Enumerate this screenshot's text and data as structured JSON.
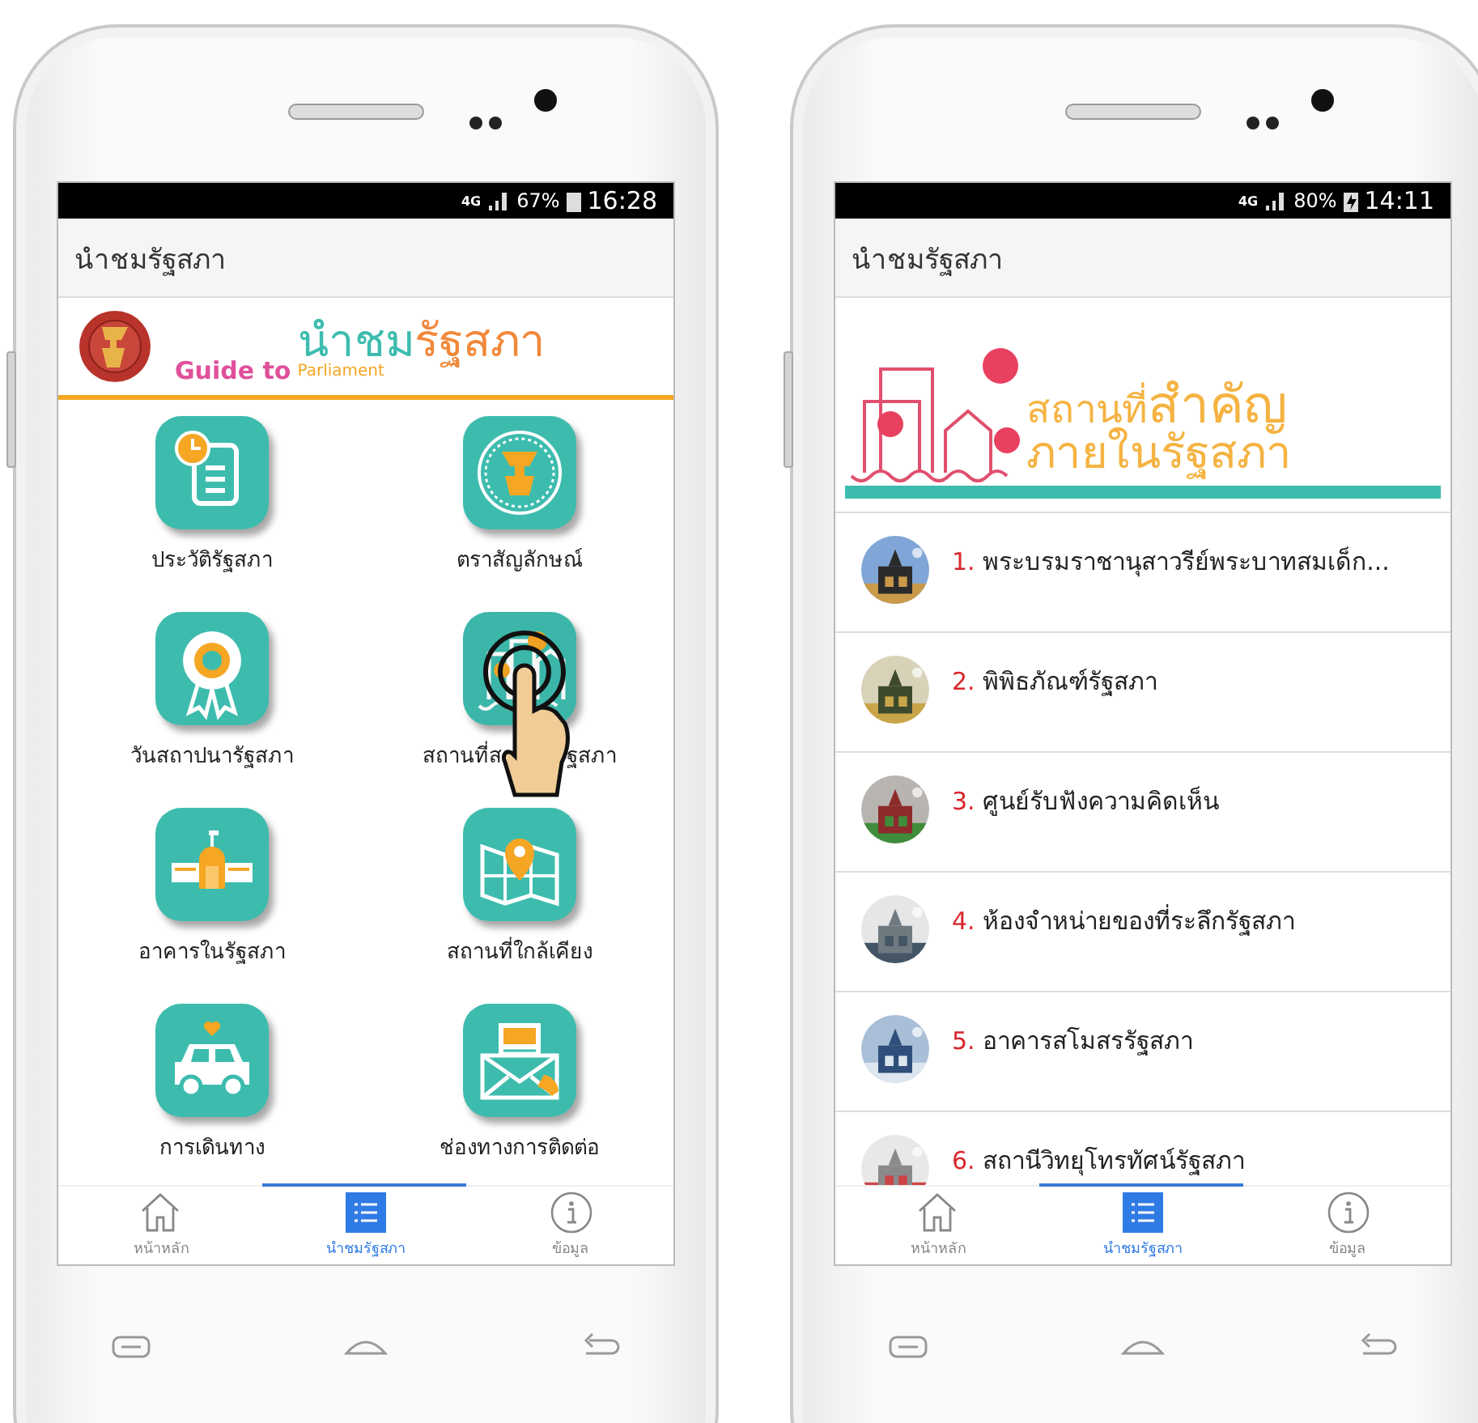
{
  "phones": [
    {
      "kind": "menu",
      "status_bar": {
        "network": "4G",
        "battery": "67%",
        "charging": false,
        "time": "16:28"
      },
      "app_bar": {
        "title": "นำชมรัฐสภา"
      },
      "banner": {
        "kind": "guide",
        "guide_to": "Guide to",
        "thai_first": "นำชม",
        "thai_second": "รัฐสภา",
        "parliament": "Parliament"
      },
      "tiles": [
        {
          "label": "ประวัติรัฐสภา"
        },
        {
          "label": "ตราสัญลักษณ์"
        },
        {
          "label": "วันสถาปนารัฐสภา"
        },
        {
          "label": "สถานที่ส",
          "label_after_hand": "ฐสภา",
          "touched": true
        },
        {
          "label": "อาคารในรัฐสภา"
        },
        {
          "label": "สถานที่ใกล้เคียง"
        },
        {
          "label": "การเดินทาง"
        },
        {
          "label": "ช่องทางการติดต่อ"
        }
      ],
      "nav": [
        {
          "label": "หน้าหลัก",
          "selected": false
        },
        {
          "label": "นำชมรัฐสภา",
          "selected": true
        },
        {
          "label": "ข้อมูล",
          "selected": false
        }
      ]
    },
    {
      "kind": "list",
      "status_bar": {
        "network": "4G",
        "battery": "80%",
        "charging": true,
        "time": "14:11"
      },
      "app_bar": {
        "title": "นำชมรัฐสภา"
      },
      "banner": {
        "kind": "places",
        "title_small": "สถานที่",
        "title_large": "สำคัญ",
        "subtitle": "ภายในรัฐสภา"
      },
      "items": [
        {
          "number": "1.",
          "title": "พระบรมราชานุสาวรีย์พระบาทสมเด็ก..."
        },
        {
          "number": "2.",
          "title": "พิพิธภัณฑ์รัฐสภา"
        },
        {
          "number": "3.",
          "title": "ศูนย์รับฟังความคิดเห็น"
        },
        {
          "number": "4.",
          "title": "ห้องจำหน่ายของที่ระลึกรัฐสภา"
        },
        {
          "number": "5.",
          "title": "อาคารสโมสรรัฐสภา"
        },
        {
          "number": "6.",
          "title": "สถานีวิทยุโทรทัศน์รัฐสภา"
        }
      ],
      "nav": [
        {
          "label": "หน้าหลัก",
          "selected": false
        },
        {
          "label": "นำชมรัฐสภา",
          "selected": true
        },
        {
          "label": "ข้อมูล",
          "selected": false
        }
      ]
    }
  ]
}
